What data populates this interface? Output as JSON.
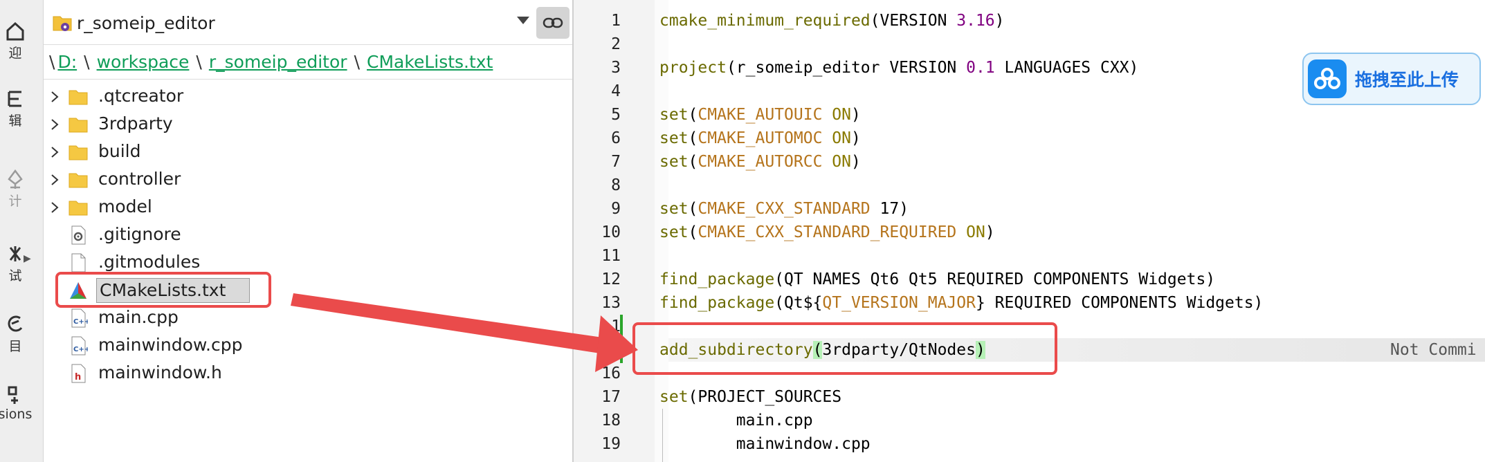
{
  "mode_bar": {
    "items": [
      {
        "label": "迎",
        "icon": "welcome-icon"
      },
      {
        "label": "辑",
        "icon": "edit-icon"
      },
      {
        "label": "计",
        "icon": "design-icon"
      },
      {
        "label": "试",
        "icon": "debug-icon"
      },
      {
        "label": "目",
        "icon": "projects-icon"
      },
      {
        "label": "sions",
        "icon": "extensions-icon"
      }
    ]
  },
  "project_panel": {
    "project_name": "r_someip_editor",
    "breadcrumb": [
      "D:",
      "workspace",
      "r_someip_editor",
      "CMakeLists.txt"
    ],
    "tree": [
      {
        "name": ".qtcreator",
        "type": "folder",
        "expandable": true
      },
      {
        "name": "3rdparty",
        "type": "folder",
        "expandable": true
      },
      {
        "name": "build",
        "type": "folder",
        "expandable": true
      },
      {
        "name": "controller",
        "type": "folder",
        "expandable": true
      },
      {
        "name": "model",
        "type": "folder",
        "expandable": true
      },
      {
        "name": ".gitignore",
        "type": "config-file",
        "expandable": false
      },
      {
        "name": ".gitmodules",
        "type": "file",
        "expandable": false
      },
      {
        "name": "CMakeLists.txt",
        "type": "cmake-file",
        "expandable": false,
        "selected": true
      },
      {
        "name": "main.cpp",
        "type": "cpp-file",
        "expandable": false
      },
      {
        "name": "mainwindow.cpp",
        "type": "cpp-file",
        "expandable": false
      },
      {
        "name": "mainwindow.h",
        "type": "header-file",
        "expandable": false
      }
    ]
  },
  "editor": {
    "line_numbers": [
      "1",
      "2",
      "3",
      "4",
      "5",
      "6",
      "7",
      "8",
      "9",
      "10",
      "11",
      "12",
      "13",
      "1",
      "1",
      "16",
      "17",
      "18",
      "19"
    ],
    "lines": [
      [
        {
          "t": "cmake_minimum_required",
          "c": "fn"
        },
        {
          "t": "(VERSION ",
          "c": ""
        },
        {
          "t": "3.16",
          "c": "num"
        },
        {
          "t": ")",
          "c": ""
        }
      ],
      [],
      [
        {
          "t": "project",
          "c": "fn"
        },
        {
          "t": "(r_someip_editor VERSION ",
          "c": ""
        },
        {
          "t": "0.1",
          "c": "num"
        },
        {
          "t": " LANGUAGES CXX)",
          "c": ""
        }
      ],
      [],
      [
        {
          "t": "set",
          "c": "fn"
        },
        {
          "t": "(",
          "c": ""
        },
        {
          "t": "CMAKE_AUTOUIC",
          "c": "var"
        },
        {
          "t": " ",
          "c": ""
        },
        {
          "t": "ON",
          "c": "on"
        },
        {
          "t": ")",
          "c": ""
        }
      ],
      [
        {
          "t": "set",
          "c": "fn"
        },
        {
          "t": "(",
          "c": ""
        },
        {
          "t": "CMAKE_AUTOMOC",
          "c": "var"
        },
        {
          "t": " ",
          "c": ""
        },
        {
          "t": "ON",
          "c": "on"
        },
        {
          "t": ")",
          "c": ""
        }
      ],
      [
        {
          "t": "set",
          "c": "fn"
        },
        {
          "t": "(",
          "c": ""
        },
        {
          "t": "CMAKE_AUTORCC",
          "c": "var"
        },
        {
          "t": " ",
          "c": ""
        },
        {
          "t": "ON",
          "c": "on"
        },
        {
          "t": ")",
          "c": ""
        }
      ],
      [],
      [
        {
          "t": "set",
          "c": "fn"
        },
        {
          "t": "(",
          "c": ""
        },
        {
          "t": "CMAKE_CXX_STANDARD",
          "c": "var"
        },
        {
          "t": " 17)",
          "c": ""
        }
      ],
      [
        {
          "t": "set",
          "c": "fn"
        },
        {
          "t": "(",
          "c": ""
        },
        {
          "t": "CMAKE_CXX_STANDARD_REQUIRED",
          "c": "var"
        },
        {
          "t": " ",
          "c": ""
        },
        {
          "t": "ON",
          "c": "on"
        },
        {
          "t": ")",
          "c": ""
        }
      ],
      [],
      [
        {
          "t": "find_package",
          "c": "fn"
        },
        {
          "t": "(QT NAMES Qt6 Qt5 REQUIRED COMPONENTS Widgets)",
          "c": ""
        }
      ],
      [
        {
          "t": "find_package",
          "c": "fn"
        },
        {
          "t": "(Qt${",
          "c": ""
        },
        {
          "t": "QT_VERSION_MAJOR",
          "c": "var"
        },
        {
          "t": "} REQUIRED COMPONENTS Widgets)",
          "c": ""
        }
      ],
      [],
      [
        {
          "t": "add_subdirectory",
          "c": "fn"
        },
        {
          "t": "(",
          "c": "paren"
        },
        {
          "t": "3rdparty/QtNodes",
          "c": ""
        },
        {
          "t": ")",
          "c": "paren"
        }
      ],
      [],
      [
        {
          "t": "set",
          "c": "fn"
        },
        {
          "t": "(PROJECT_SOURCES",
          "c": ""
        }
      ],
      [
        {
          "t": "        main.cpp",
          "c": ""
        }
      ],
      [
        {
          "t": "        mainwindow.cpp",
          "c": ""
        }
      ]
    ],
    "blame": "Not Commi"
  },
  "upload_widget": {
    "label": "拖拽至此上传"
  },
  "colors": {
    "annotation": "#ea4b4b",
    "link": "#0f9d58",
    "function": "#6a6a00",
    "variable": "#b5741c",
    "number": "#800080"
  }
}
